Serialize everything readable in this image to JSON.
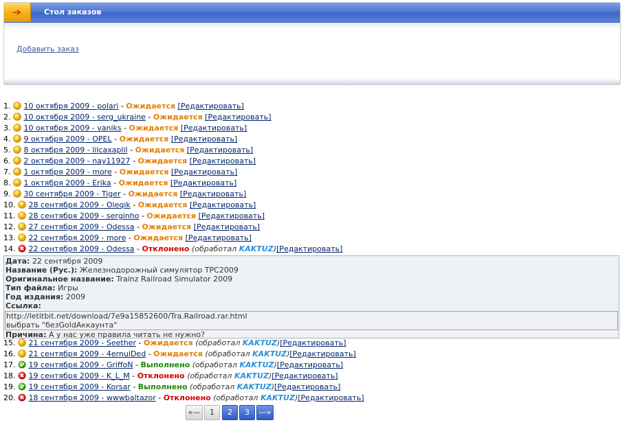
{
  "panel": {
    "title": "Стол заказов",
    "add_order": "Добавить заказ"
  },
  "colors": {
    "header_blue": "#4f78d6",
    "header_orange": "#f4b21a",
    "waiting": "#e47f00",
    "rejected": "#d10000",
    "done": "#1d8a00",
    "admin": "#2e8fd6"
  },
  "orders_top": [
    {
      "num": "1.",
      "status_icon": "pending-icon",
      "link": "10 октября 2009 - polari",
      "sep": "-",
      "status": "Ожидается",
      "status_class": "wait",
      "edit": "[Редактировать]"
    },
    {
      "num": "2.",
      "status_icon": "pending-icon",
      "link": "10 октября 2009 - serg_ukraine",
      "sep": "-",
      "status": "Ожидается",
      "status_class": "wait",
      "edit": "[Редактировать]"
    },
    {
      "num": "3.",
      "status_icon": "pending-icon",
      "link": "10 октября 2009 - vaniks",
      "sep": "-",
      "status": "Ожидается",
      "status_class": "wait",
      "edit": "[Редактировать]"
    },
    {
      "num": "4.",
      "status_icon": "pending-icon",
      "link": "9 октября 2009 - OPEL",
      "sep": "-",
      "status": "Ожидается",
      "status_class": "wait",
      "edit": "[Редактировать]"
    },
    {
      "num": "5.",
      "status_icon": "pending-icon",
      "link": "8 октября 2009 - lilcaxaplil",
      "sep": "-",
      "status": "Ожидается",
      "status_class": "wait",
      "edit": "[Редактировать]"
    },
    {
      "num": "6.",
      "status_icon": "pending-icon",
      "link": "2 октября 2009 - nay11927",
      "sep": "-",
      "status": "Ожидается",
      "status_class": "wait",
      "edit": "[Редактировать]"
    },
    {
      "num": "7.",
      "status_icon": "pending-icon",
      "link": "1 октября 2009 - more",
      "sep": "-",
      "status": "Ожидается",
      "status_class": "wait",
      "edit": "[Редактировать]"
    },
    {
      "num": "8.",
      "status_icon": "pending-icon",
      "link": "1 октября 2009 - Erika",
      "sep": "-",
      "status": "Ожидается",
      "status_class": "wait",
      "edit": "[Редактировать]"
    },
    {
      "num": "9.",
      "status_icon": "pending-icon",
      "link": "30 сентября 2009 - Tiger",
      "sep": "-",
      "status": "Ожидается",
      "status_class": "wait",
      "edit": "[Редактировать]"
    },
    {
      "num": "10.",
      "status_icon": "pending-icon",
      "link": "28 сентября 2009 - Oleqik",
      "sep": "-",
      "status": "Ожидается",
      "status_class": "wait",
      "edit": "[Редактировать]"
    },
    {
      "num": "11.",
      "status_icon": "pending-icon",
      "link": "28 сентября 2009 - serginho",
      "sep": "-",
      "status": "Ожидается",
      "status_class": "wait",
      "edit": "[Редактировать]"
    },
    {
      "num": "12.",
      "status_icon": "pending-icon",
      "link": "27 сентября 2009 - Odessa",
      "sep": "-",
      "status": "Ожидается",
      "status_class": "wait",
      "edit": "[Редактировать]"
    },
    {
      "num": "13.",
      "status_icon": "pending-icon",
      "link": "22 сентября 2009 - more",
      "sep": "-",
      "status": "Ожидается",
      "status_class": "wait",
      "edit": "[Редактировать]"
    },
    {
      "num": "14.",
      "status_icon": "rejected-icon",
      "link": "22 сентября 2009 - Odessa",
      "sep": "-",
      "status": "Отклонено",
      "status_class": "rej",
      "processed_by": "(обработал",
      "admin": "KAKTUZ",
      "processed_close": ")",
      "edit": "[Редактировать]"
    }
  ],
  "details": {
    "date_label": "Дата:",
    "date_value": "22 сентября 2009",
    "name_ru_label": "Название (Рус.):",
    "name_ru_value": "Железнодорожный симулятор ТРС2009",
    "original_label": "Оригинальное название:",
    "original_value": "Trainz Railroad Simulator 2009",
    "filetype_label": "Тип файла:",
    "filetype_value": "Игры",
    "year_label": "Год издания:",
    "year_value": "2009",
    "link_label": "Ссылка:",
    "link_line1": "http://letitbit.net/download/7e9a15852600/Tra.Railroad.rar.html",
    "link_line2": "выбрать \"безGoldАккаунта\"",
    "reason_label": "Причина:",
    "reason_value": "А у нас уже правила читать не нужно?"
  },
  "orders_bottom": [
    {
      "num": "15.",
      "status_icon": "pending-icon",
      "link": "21 сентября 2009 - Seether",
      "sep": "-",
      "status": "Ожидается",
      "status_class": "wait",
      "processed_by": "(обработал",
      "admin": "KAKTUZ",
      "processed_close": ")",
      "edit": "[Редактировать]"
    },
    {
      "num": "16.",
      "status_icon": "pending-icon",
      "link": "21 сентября 2009 - 4ernuiDed",
      "sep": "-",
      "status": "Ожидается",
      "status_class": "wait",
      "processed_by": "(обработал",
      "admin": "KAKTUZ",
      "processed_close": ")",
      "edit": "[Редактировать]"
    },
    {
      "num": "17.",
      "status_icon": "done-icon",
      "link": "19 сентября 2009 - GriffoN",
      "sep": "-",
      "status": "Выполнено",
      "status_class": "done",
      "processed_by": "(обработал",
      "admin": "KAKTUZ",
      "processed_close": ")",
      "edit": "[Редактировать]"
    },
    {
      "num": "18.",
      "status_icon": "rejected-icon",
      "link": "19 сентября 2009 - K_L_M",
      "sep": "-",
      "status": "Отклонено",
      "status_class": "rej",
      "processed_by": "(обработал",
      "admin": "KAKTUZ",
      "processed_close": ")",
      "edit": "[Редактировать]"
    },
    {
      "num": "19.",
      "status_icon": "done-icon",
      "link": "19 сентября 2009 - Korsar",
      "sep": "-",
      "status": "Выполнено",
      "status_class": "done",
      "processed_by": "(обработал",
      "admin": "KAKTUZ",
      "processed_close": ")",
      "edit": "[Редактировать]"
    },
    {
      "num": "20.",
      "status_icon": "rejected-icon",
      "link": "18 сентября 2009 - wwwbaltazor",
      "sep": "-",
      "status": "Отклонено",
      "status_class": "rej",
      "processed_by": "(обработал",
      "admin": "KAKTUZ",
      "processed_close": ")",
      "edit": "[Редактировать]"
    }
  ],
  "pagination": {
    "prev": "«—",
    "pages": [
      "1",
      "2",
      "3"
    ],
    "current_page": "1",
    "next": "—»"
  }
}
